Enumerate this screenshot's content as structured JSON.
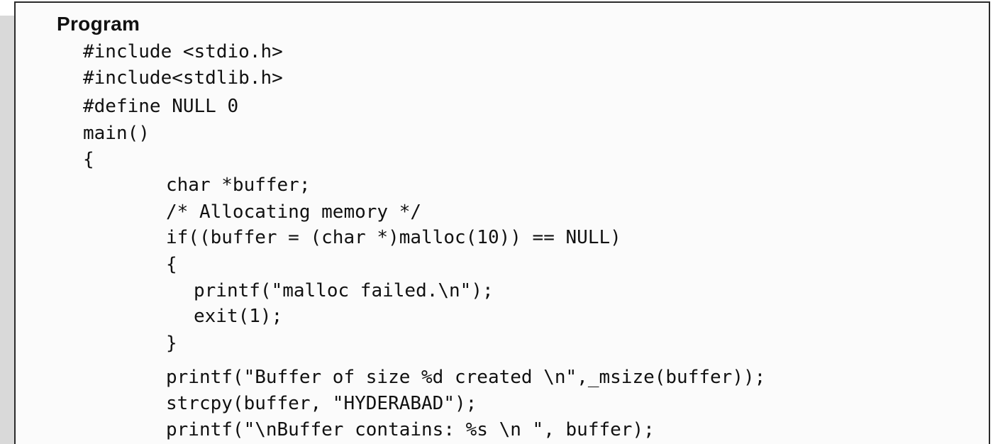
{
  "title": "Program",
  "code_lines": [
    "#include <stdio.h>",
    "#include<stdlib.h>",
    "#define NULL 0",
    "main()",
    "{",
    "char *buffer;",
    "/* Allocating memory */",
    "if((buffer = (char *)malloc(10)) == NULL)",
    "{",
    "printf(\"malloc failed.\\n\");",
    "exit(1);",
    "}",
    "printf(\"Buffer of size %d created \\n\",_msize(buffer));",
    "strcpy(buffer, \"HYDERABAD\");",
    "printf(\"\\nBuffer contains: %s \\n \", buffer);"
  ]
}
